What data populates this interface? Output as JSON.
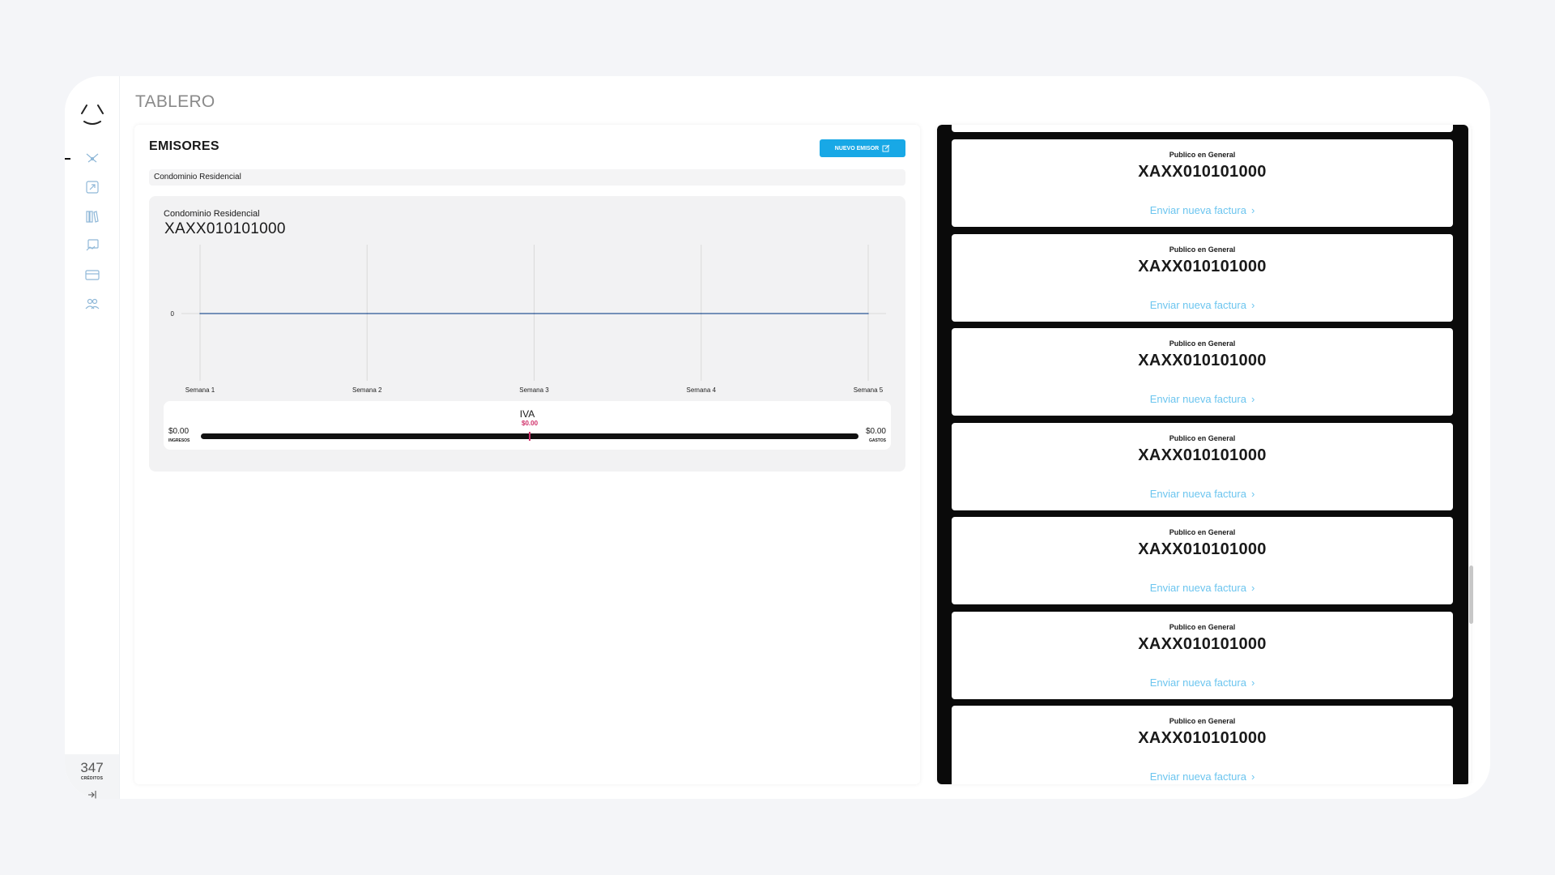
{
  "sidebar": {
    "credits_count": "347",
    "credits_label": "CRÉDITOS"
  },
  "header": {
    "title": "TABLERO"
  },
  "emisores": {
    "title": "EMISORES",
    "new_button_label": "NUEVO EMISOR",
    "selected_emisor": "Condominio Residencial"
  },
  "chart": {
    "subtitle": "Condominio Residencial",
    "rfc": "XAXX010101000"
  },
  "chart_data": {
    "type": "line",
    "categories": [
      "Semana 1",
      "Semana 2",
      "Semana 3",
      "Semana 4",
      "Semana 5"
    ],
    "series": [
      {
        "values": [
          0,
          0,
          0,
          0,
          0
        ],
        "color": "#4a6fa5"
      }
    ],
    "yticks": [
      "0"
    ],
    "grid": true
  },
  "iva": {
    "label": "IVA",
    "value": "$0.00",
    "ingresos_value": "$0.00",
    "ingresos_label": "INGRESOS",
    "gastos_value": "$0.00",
    "gastos_label": "GASTOS",
    "marker_fraction": 0.5
  },
  "clientes": [
    {
      "name": "Publico en General",
      "rfc": "XAXX010101000",
      "action": "Enviar nueva factura"
    },
    {
      "name": "Publico en General",
      "rfc": "XAXX010101000",
      "action": "Enviar nueva factura"
    },
    {
      "name": "Publico en General",
      "rfc": "XAXX010101000",
      "action": "Enviar nueva factura"
    },
    {
      "name": "Publico en General",
      "rfc": "XAXX010101000",
      "action": "Enviar nueva factura"
    },
    {
      "name": "Publico en General",
      "rfc": "XAXX010101000",
      "action": "Enviar nueva factura"
    },
    {
      "name": "Publico en General",
      "rfc": "XAXX010101000",
      "action": "Enviar nueva factura"
    },
    {
      "name": "Publico en General",
      "rfc": "XAXX010101000",
      "action": "Enviar nueva factura"
    }
  ],
  "colors": {
    "accent": "#18a8e6",
    "link": "#6cc5ef",
    "iva_marker": "#d0306a",
    "list_background": "#0a0a0a"
  },
  "icons": {
    "logo": "logo-icon",
    "nav": [
      "dashboard-icon",
      "export-icon",
      "library-icon",
      "invoice-icon",
      "card-icon",
      "users-icon"
    ],
    "logout": "logout-icon",
    "edit": "edit-icon",
    "chevron": "chevron-right-icon"
  }
}
